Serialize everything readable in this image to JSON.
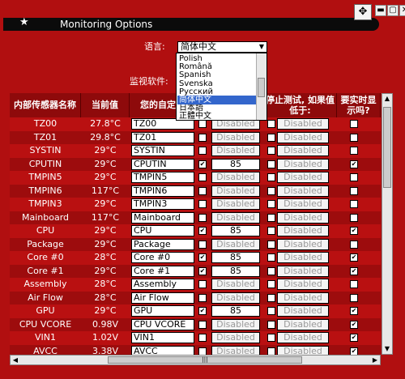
{
  "window": {
    "title": "Monitoring Options",
    "buttons": [
      "✥",
      "▬",
      "▢",
      "✕"
    ]
  },
  "settings": {
    "language_label": "语言:",
    "language_value": "简体中文",
    "monitor_label": "监视软件:"
  },
  "dropdown": {
    "options": [
      "Polish",
      "Română",
      "Spanish",
      "Svenska",
      "Русский",
      "简体中文",
      "日本語",
      "正體中文"
    ],
    "selected_index": 5
  },
  "table": {
    "headers": [
      "内部传感器名称",
      "当前值",
      "您的自定义",
      "",
      "停止测试, 如果值低于:",
      "要实时显示吗?"
    ],
    "rows": [
      {
        "name": "TZ00",
        "value": "27.8°C",
        "custom": "TZ00",
        "cb1": false,
        "t1": "Disabled",
        "cb2": false,
        "t2": "Disabled",
        "cb3": false
      },
      {
        "name": "TZ01",
        "value": "29.8°C",
        "custom": "TZ01",
        "cb1": false,
        "t1": "Disabled",
        "cb2": false,
        "t2": "Disabled",
        "cb3": false
      },
      {
        "name": "SYSTIN",
        "value": "29°C",
        "custom": "SYSTIN",
        "cb1": false,
        "t1": "Disabled",
        "cb2": false,
        "t2": "Disabled",
        "cb3": false
      },
      {
        "name": "CPUTIN",
        "value": "29°C",
        "custom": "CPUTIN",
        "cb1": true,
        "t1": "85",
        "cb2": false,
        "t2": "Disabled",
        "cb3": true
      },
      {
        "name": "TMPIN5",
        "value": "29°C",
        "custom": "TMPIN5",
        "cb1": false,
        "t1": "Disabled",
        "cb2": false,
        "t2": "Disabled",
        "cb3": false
      },
      {
        "name": "TMPIN6",
        "value": "117°C",
        "custom": "TMPIN6",
        "cb1": false,
        "t1": "Disabled",
        "cb2": false,
        "t2": "Disabled",
        "cb3": false
      },
      {
        "name": "TMPIN3",
        "value": "29°C",
        "custom": "TMPIN3",
        "cb1": false,
        "t1": "Disabled",
        "cb2": false,
        "t2": "Disabled",
        "cb3": false
      },
      {
        "name": "Mainboard",
        "value": "117°C",
        "custom": "Mainboard",
        "cb1": false,
        "t1": "Disabled",
        "cb2": false,
        "t2": "Disabled",
        "cb3": false
      },
      {
        "name": "CPU",
        "value": "29°C",
        "custom": "CPU",
        "cb1": true,
        "t1": "85",
        "cb2": false,
        "t2": "Disabled",
        "cb3": true
      },
      {
        "name": "Package",
        "value": "29°C",
        "custom": "Package",
        "cb1": false,
        "t1": "Disabled",
        "cb2": false,
        "t2": "Disabled",
        "cb3": false
      },
      {
        "name": "Core #0",
        "value": "28°C",
        "custom": "Core #0",
        "cb1": true,
        "t1": "85",
        "cb2": false,
        "t2": "Disabled",
        "cb3": true
      },
      {
        "name": "Core #1",
        "value": "29°C",
        "custom": "Core #1",
        "cb1": true,
        "t1": "85",
        "cb2": false,
        "t2": "Disabled",
        "cb3": true
      },
      {
        "name": "Assembly",
        "value": "28°C",
        "custom": "Assembly",
        "cb1": false,
        "t1": "Disabled",
        "cb2": false,
        "t2": "Disabled",
        "cb3": false
      },
      {
        "name": "Air Flow",
        "value": "28°C",
        "custom": "Air Flow",
        "cb1": false,
        "t1": "Disabled",
        "cb2": false,
        "t2": "Disabled",
        "cb3": false
      },
      {
        "name": "GPU",
        "value": "29°C",
        "custom": "GPU",
        "cb1": true,
        "t1": "85",
        "cb2": false,
        "t2": "Disabled",
        "cb3": true
      },
      {
        "name": "CPU VCORE",
        "value": "0.98V",
        "custom": "CPU VCORE",
        "cb1": false,
        "t1": "Disabled",
        "cb2": false,
        "t2": "Disabled",
        "cb3": true
      },
      {
        "name": "VIN1",
        "value": "1.02V",
        "custom": "VIN1",
        "cb1": false,
        "t1": "Disabled",
        "cb2": false,
        "t2": "Disabled",
        "cb3": true
      },
      {
        "name": "AVCC",
        "value": "3.38V",
        "custom": "AVCC",
        "cb1": false,
        "t1": "Disabled",
        "cb2": false,
        "t2": "Disabled",
        "cb3": true
      }
    ]
  },
  "colors": {
    "background": "#b10f10",
    "table_bg": "#8e0a0b",
    "row_a": "#b91011",
    "row_b": "#9d0c0d",
    "text": "#ffffff",
    "selection": "#3366cc"
  }
}
